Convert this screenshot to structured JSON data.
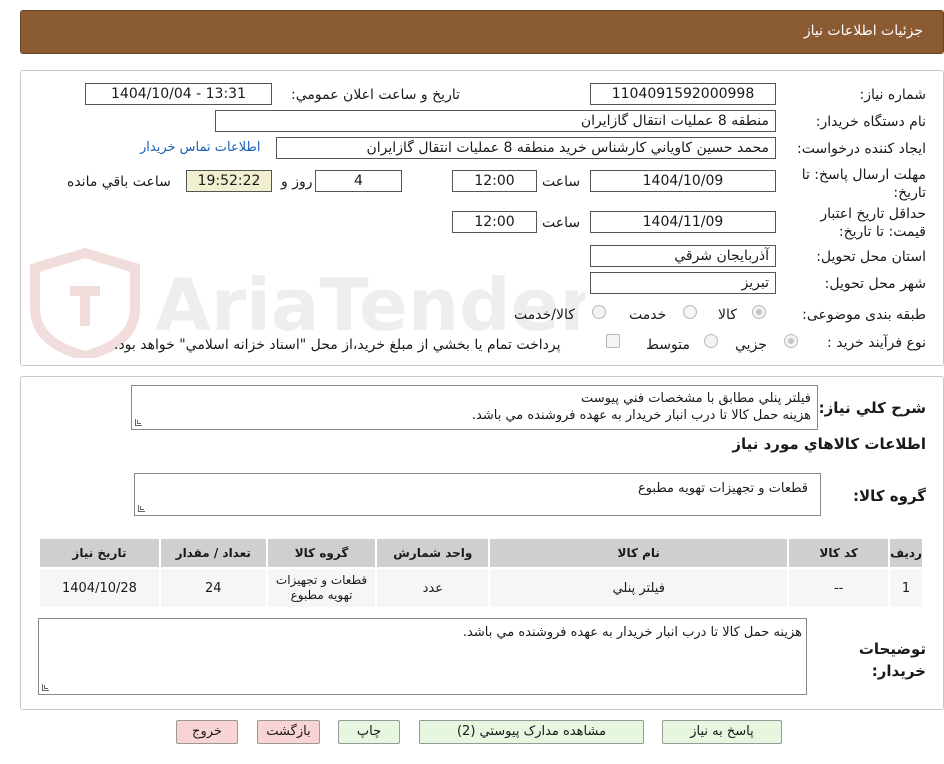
{
  "header": {
    "title": "جزئیات اطلاعات نیاز"
  },
  "form": {
    "need_number_label": "شماره نیاز:",
    "need_number": "1104091592000998",
    "announce_label": "تاریخ و ساعت اعلان عمومي:",
    "announce_value": "1404/10/04 - 13:31",
    "buyer_org_label": "نام دستگاه خريدار:",
    "buyer_org": "منطقه 8 عمليات انتقال گازايران",
    "creator_label": "ايجاد کننده درخواست:",
    "creator": "محمد حسين کاوياني کارشناس خريد منطقه 8 عمليات انتقال گازايران",
    "contact_link": "اطلاعات تماس خريدار",
    "deadline_label": "مهلت ارسال پاسخ: تا تاریخ:",
    "deadline_date": "1404/10/09",
    "time_label": "ساعت",
    "deadline_time": "12:00",
    "days": "4",
    "days_suffix": "روز و",
    "remaining_time": "19:52:22",
    "remaining_suffix": "ساعت باقي مانده",
    "validity_label": "حداقل تاريخ اعتبار قيمت: تا تاريخ:",
    "validity_date": "1404/11/09",
    "validity_time": "12:00",
    "province_label": "استان محل تحويل:",
    "province": "آذربايجان شرقي",
    "city_label": "شهر محل تحويل:",
    "city": "تبريز",
    "category_label": "طبقه بندی موضوعی:",
    "category_options": [
      "کالا",
      "خدمت",
      "کالا/خدمت"
    ],
    "process_label": "نوع فرآيند خريد :",
    "process_options": [
      "جزيي",
      "متوسط"
    ],
    "payment_note": "پرداخت تمام يا بخشي از مبلغ خريد،از محل \"اسناد خزانه اسلامي\" خواهد بود."
  },
  "summary": {
    "label": "شرح کلي نياز:",
    "line1": "فيلتر پنلي مطابق با مشخصات فني پيوست",
    "line2": "هزينه حمل کالا تا درب انبار خريدار به عهده فروشنده مي باشد."
  },
  "goods_section": {
    "title": "اطلاعات کالاهاي مورد نياز",
    "group_label": "گروه کالا:",
    "group_value": "قطعات و تجهيزات تهويه مطبوع"
  },
  "table": {
    "headers": [
      "رديف",
      "کد کالا",
      "نام کالا",
      "واحد شمارش",
      "گروه کالا",
      "تعداد / مقدار",
      "تاريخ نياز"
    ],
    "rows": [
      [
        "1",
        "--",
        "فيلتر پنلي",
        "عدد",
        "قطعات و تجهيزات تهويه مطبوع",
        "24",
        "1404/10/28"
      ]
    ]
  },
  "buyer_notes": {
    "label": "توضيحات خريدار:",
    "text": "هزينه حمل کالا تا درب انبار خريدار به عهده فروشنده مي باشد."
  },
  "buttons": {
    "reply": "پاسخ به نياز",
    "attachments": "مشاهده مدارک پيوستي (2)",
    "print": "چاپ",
    "back": "بازگشت",
    "exit": "خروج"
  },
  "watermark": {
    "text": "AriaTender.neT"
  },
  "colors": {
    "header_bg": "#8a5a32",
    "button_green": "#e6f6df",
    "button_pink": "#f9d4d4",
    "link": "#1a5fb4",
    "table_header": "#cfcfcf"
  }
}
